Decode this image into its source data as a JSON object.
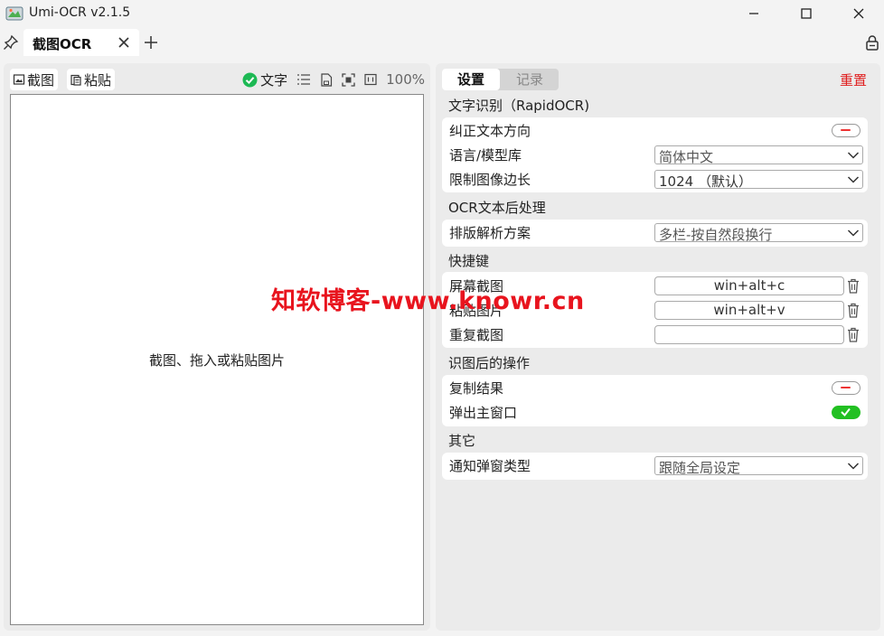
{
  "window": {
    "title": "Umi-OCR v2.1.5"
  },
  "tabs": [
    {
      "label": "截图OCR"
    }
  ],
  "left": {
    "screenshot_label": "截图",
    "paste_label": "粘贴",
    "text_toggle_label": "文字",
    "zoom": "100%",
    "canvas_hint": "截图、拖入或粘贴图片"
  },
  "right": {
    "segments": {
      "settings": "设置",
      "records": "记录"
    },
    "reset_label": "重置",
    "sections": {
      "ocr": {
        "title": "文字识别（RapidOCR)",
        "rows": {
          "correct_direction": "纠正文本方向",
          "language_model": "语言/模型库",
          "language_value": "简体中文",
          "limit_side": "限制图像边长",
          "limit_value": "1024 （默认）"
        }
      },
      "post": {
        "title": "OCR文本后处理",
        "layout_label": "排版解析方案",
        "layout_value": "多栏-按自然段换行"
      },
      "hotkeys": {
        "title": "快捷键",
        "screen_capture": "屏幕截图",
        "screen_capture_key": "win+alt+c",
        "paste_image": "粘贴图片",
        "paste_image_key": "win+alt+v",
        "repeat_capture": "重复截图",
        "repeat_capture_key": ""
      },
      "after": {
        "title": "识图后的操作",
        "copy_result": "复制结果",
        "popup_main": "弹出主窗口"
      },
      "other": {
        "title": "其它",
        "notify_type": "通知弹窗类型",
        "notify_value": "跟随全局设定"
      }
    }
  },
  "switch_states": {
    "correct_direction": false,
    "copy_result": false,
    "popup_main": true
  },
  "watermark": "知软博客-www.knowr.cn",
  "colors": {
    "accent_red": "#e02020",
    "switch_on": "#22c022"
  }
}
